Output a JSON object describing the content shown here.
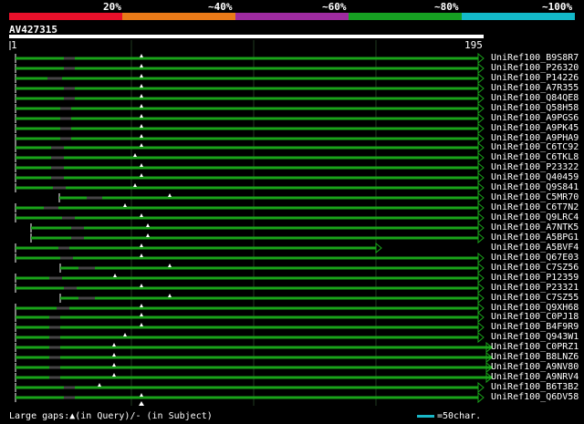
{
  "legend": [
    {
      "label": "20%",
      "color": "#e8102a"
    },
    {
      "label": "~40%",
      "color": "#ea7a18"
    },
    {
      "label": "~60%",
      "color": "#9e2ba0"
    },
    {
      "label": "~80%",
      "color": "#16a022"
    },
    {
      "label": "~100%",
      "color": "#13b9c9"
    }
  ],
  "query": {
    "id": "AV427315",
    "start": "1",
    "end": "195"
  },
  "colors": {
    "hit": "#1aa31a",
    "marker": "#ffffff",
    "gap": "#444444",
    "grid": "#1f3a1f",
    "scale": "#19b8c8"
  },
  "hits": [
    {
      "name": "UniRef100_B9S8R7"
    },
    {
      "name": "UniRef100_P26320"
    },
    {
      "name": "UniRef100_P14226"
    },
    {
      "name": "UniRef100_A7R355"
    },
    {
      "name": "UniRef100_Q84QE8"
    },
    {
      "name": "UniRef100_Q58H58"
    },
    {
      "name": "UniRef100_A9PGS6"
    },
    {
      "name": "UniRef100_A9PK45"
    },
    {
      "name": "UniRef100_A9PHA9"
    },
    {
      "name": "UniRef100_C6TC92"
    },
    {
      "name": "UniRef100_C6TKL8"
    },
    {
      "name": "UniRef100_P23322"
    },
    {
      "name": "UniRef100_Q40459"
    },
    {
      "name": "UniRef100_Q9S841"
    },
    {
      "name": "UniRef100_C5MR70"
    },
    {
      "name": "UniRef100_C6T7N2"
    },
    {
      "name": "UniRef100_Q9LRC4"
    },
    {
      "name": "UniRef100_A7NTK5"
    },
    {
      "name": "UniRef100_A5BPG1"
    },
    {
      "name": "UniRef100_A5BVF4"
    },
    {
      "name": "UniRef100_Q67E03"
    },
    {
      "name": "UniRef100_C7SZ56"
    },
    {
      "name": "UniRef100_P12359"
    },
    {
      "name": "UniRef100_P23321"
    },
    {
      "name": "UniRef100_C7SZ55"
    },
    {
      "name": "UniRef100_Q9XH68"
    },
    {
      "name": "UniRef100_C0PJ18"
    },
    {
      "name": "UniRef100_B4F9R9"
    },
    {
      "name": "UniRef100_Q943W1"
    },
    {
      "name": "UniRef100_C0PRZ1"
    },
    {
      "name": "UniRef100_B8LNZ6"
    },
    {
      "name": "UniRef100_A9NV80"
    },
    {
      "name": "UniRef100_A9NRV4"
    },
    {
      "name": "UniRef100_B6T3B2"
    },
    {
      "name": "UniRef100_Q6DV58"
    }
  ],
  "footer": {
    "gaps": "Large gaps:▲(in Query)/- (in Subject)",
    "scale": "=50char."
  }
}
